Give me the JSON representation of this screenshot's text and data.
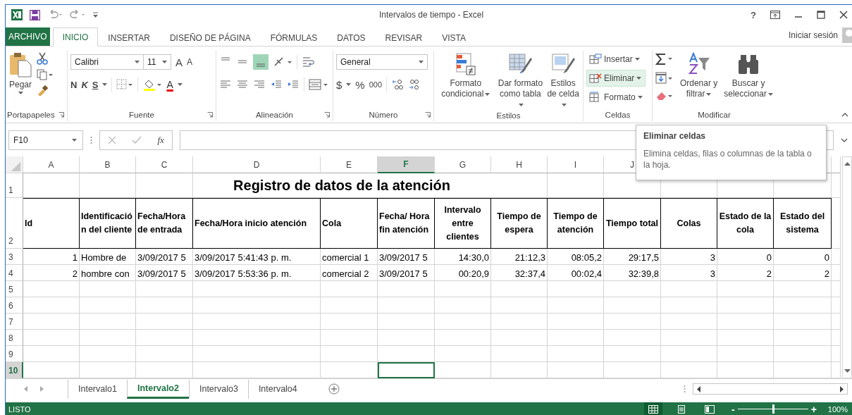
{
  "window": {
    "title": "Intervalos de tiempo - Excel",
    "help": "?"
  },
  "ribbon_tabs": [
    {
      "label": "ARCHIVO",
      "kind": "file",
      "selected": false
    },
    {
      "label": "INICIO",
      "kind": "tab",
      "selected": true
    },
    {
      "label": "INSERTAR",
      "kind": "tab",
      "selected": false
    },
    {
      "label": "DISEÑO DE PÁGINA",
      "kind": "tab",
      "selected": false
    },
    {
      "label": "FÓRMULAS",
      "kind": "tab",
      "selected": false
    },
    {
      "label": "DATOS",
      "kind": "tab",
      "selected": false
    },
    {
      "label": "REVISAR",
      "kind": "tab",
      "selected": false
    },
    {
      "label": "VISTA",
      "kind": "tab",
      "selected": false
    }
  ],
  "account": {
    "label": "Iniciar sesión"
  },
  "ribbon": {
    "groups": [
      {
        "kind": "clipboard",
        "label": "Portapapeles",
        "paste": "Pegar"
      },
      {
        "kind": "font",
        "label": "Fuente",
        "font": "Calibri",
        "size": "11",
        "grow": "A",
        "shrink": "A",
        "styles": [
          "N",
          "K",
          "S"
        ],
        "color_letter": "A"
      },
      {
        "kind": "alignment",
        "label": "Alineación"
      },
      {
        "kind": "number",
        "label": "Número",
        "format": "General",
        "currency": "$",
        "percent": "%",
        "thousands": "000"
      },
      {
        "kind": "styles",
        "label": "Estilos",
        "buttons": [
          "Formato condicional",
          "Dar formato como tabla",
          "Estilos de celda"
        ]
      },
      {
        "kind": "cells",
        "label": "Celdas",
        "items": [
          {
            "label": "Insertar",
            "highlighted": false
          },
          {
            "label": "Eliminar",
            "highlighted": true
          },
          {
            "label": "Formato",
            "highlighted": false
          }
        ]
      },
      {
        "kind": "editing",
        "label": "Modificar",
        "buttons": [
          "Ordenar y filtrar",
          "Buscar y seleccionar"
        ]
      }
    ]
  },
  "formula_bar": {
    "name_box": "F10",
    "function_label": "fx"
  },
  "tooltip": {
    "title": "Eliminar celdas",
    "text": "Elimina celdas, filas o columnas de la tabla o la hoja."
  },
  "grid": {
    "columns": [
      {
        "letter": "A",
        "selected": false
      },
      {
        "letter": "B",
        "selected": false
      },
      {
        "letter": "C",
        "selected": false
      },
      {
        "letter": "D",
        "selected": false
      },
      {
        "letter": "E",
        "selected": false
      },
      {
        "letter": "F",
        "selected": true
      },
      {
        "letter": "G",
        "selected": false
      },
      {
        "letter": "H",
        "selected": false
      },
      {
        "letter": "I",
        "selected": false
      },
      {
        "letter": "J",
        "selected": false
      }
    ],
    "rows": [
      {
        "number": "1",
        "kind": "title",
        "selected": false,
        "title": "Registro de datos de la atención"
      },
      {
        "number": "2",
        "kind": "header",
        "selected": false,
        "cells": [
          {
            "text": "Id",
            "centered": false
          },
          {
            "text": "Identificación del cliente",
            "centered": false
          },
          {
            "text": "Fecha/Hora de entrada",
            "centered": false
          },
          {
            "text": "Fecha/Hora inicio atención",
            "centered": false
          },
          {
            "text": "Cola",
            "centered": false
          },
          {
            "text": "Fecha/ Hora fin atención",
            "centered": false
          },
          {
            "text": "Intervalo entre clientes",
            "centered": true
          },
          {
            "text": "Tiempo de espera",
            "centered": true
          },
          {
            "text": "Tiempo de atención",
            "centered": true
          },
          {
            "text": "Tiempo total",
            "centered": true
          },
          {
            "text": "Colas",
            "centered": true
          },
          {
            "text": "Estado de la cola",
            "centered": true
          },
          {
            "text": "Estado del sistema",
            "centered": true
          }
        ]
      },
      {
        "number": "3",
        "kind": "data",
        "selected": false,
        "cells": [
          {
            "text": "1",
            "numeric": true
          },
          {
            "text": "Hombre de",
            "numeric": false
          },
          {
            "text": "3/09/2017 5",
            "numeric": false
          },
          {
            "text": "3/09/2017 5:41:43 p. m.",
            "numeric": false
          },
          {
            "text": "comercial 1",
            "numeric": false
          },
          {
            "text": "3/09/2017 5",
            "numeric": false
          },
          {
            "text": "14:30,0",
            "numeric": true
          },
          {
            "text": "21:12,3",
            "numeric": true
          },
          {
            "text": "08:05,2",
            "numeric": true
          },
          {
            "text": "29:17,5",
            "numeric": true
          },
          {
            "text": "3",
            "numeric": true
          },
          {
            "text": "0",
            "numeric": true
          },
          {
            "text": "0",
            "numeric": true
          }
        ]
      },
      {
        "number": "4",
        "kind": "data",
        "selected": false,
        "cells": [
          {
            "text": "2",
            "numeric": true
          },
          {
            "text": "hombre con",
            "numeric": false
          },
          {
            "text": "3/09/2017 5",
            "numeric": false
          },
          {
            "text": "3/09/2017 5:53:36 p. m.",
            "numeric": false
          },
          {
            "text": "comercial 2",
            "numeric": false
          },
          {
            "text": "3/09/2017 5",
            "numeric": false
          },
          {
            "text": "00:20,9",
            "numeric": true
          },
          {
            "text": "32:37,4",
            "numeric": true
          },
          {
            "text": "00:02,4",
            "numeric": true
          },
          {
            "text": "32:39,8",
            "numeric": true
          },
          {
            "text": "3",
            "numeric": true
          },
          {
            "text": "2",
            "numeric": true
          },
          {
            "text": "2",
            "numeric": true
          }
        ]
      },
      {
        "number": "5",
        "kind": "empty",
        "selected": false
      },
      {
        "number": "6",
        "kind": "empty",
        "selected": false
      },
      {
        "number": "7",
        "kind": "empty",
        "selected": false
      },
      {
        "number": "8",
        "kind": "empty",
        "selected": false
      },
      {
        "number": "9",
        "kind": "empty",
        "selected": false
      },
      {
        "number": "10",
        "kind": "empty",
        "selected": true
      }
    ]
  },
  "sheet_tabs": [
    {
      "label": "Intervalo1",
      "selected": false
    },
    {
      "label": "Intervalo2",
      "selected": true
    },
    {
      "label": "Intervalo3",
      "selected": false
    },
    {
      "label": "Intervalo4",
      "selected": false
    }
  ],
  "status_bar": {
    "text": "LISTO",
    "views": [
      {
        "selected": true
      },
      {
        "selected": false
      },
      {
        "selected": false
      }
    ],
    "zoom_out": "-",
    "zoom_in": "+",
    "zoom": {
      "level": 0.5
    },
    "zoom_label": "100%"
  }
}
